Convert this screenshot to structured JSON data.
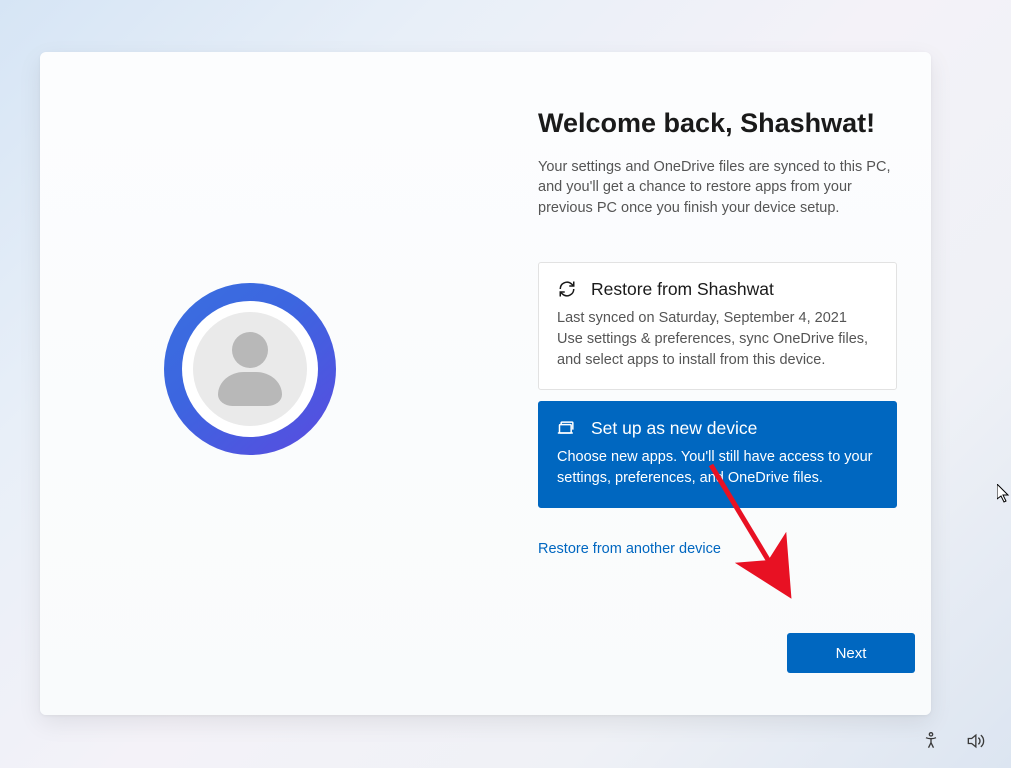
{
  "heading": "Welcome back, Shashwat!",
  "subheading": "Your settings and OneDrive files are synced to this PC, and you'll get a chance to restore apps from your previous PC once you finish your device setup.",
  "options": {
    "restore": {
      "title": "Restore from Shashwat",
      "desc": "Last synced on Saturday, September 4, 2021\nUse settings & preferences, sync OneDrive files, and select apps to install from this device."
    },
    "new_device": {
      "title": "Set up as new device",
      "desc": "Choose new apps. You'll still have access to your settings, preferences, and OneDrive files."
    }
  },
  "link": "Restore from another device",
  "next_label": "Next"
}
